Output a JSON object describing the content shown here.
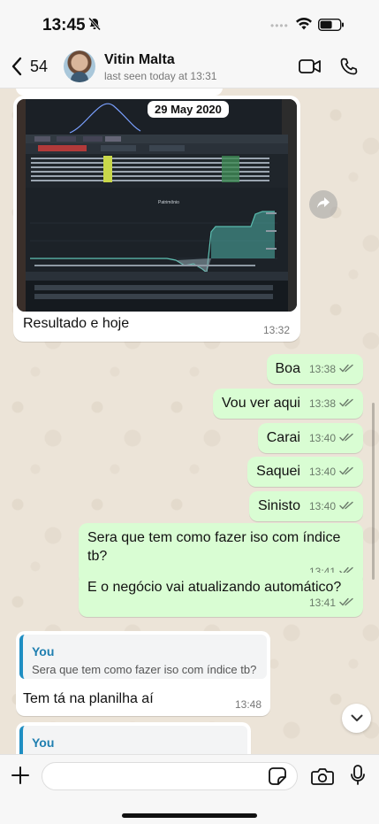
{
  "status_bar": {
    "time": "13:45",
    "icons": [
      "bell-slash-icon",
      "wifi-icon",
      "battery-icon"
    ]
  },
  "header": {
    "back_count": "54",
    "contact_name": "Vitin Malta",
    "last_seen": "last seen today at 13:31",
    "icons": [
      "chevron-left-icon",
      "video-call-icon",
      "phone-call-icon"
    ]
  },
  "messages": {
    "image_message": {
      "date_overlay": "29 May 2020",
      "caption": "Resultado e hoje",
      "time": "13:32",
      "chart_title": "Patrimônio"
    },
    "outgoing": [
      {
        "text": "Boa",
        "time": "13:38"
      },
      {
        "text": "Vou ver aqui",
        "time": "13:38"
      },
      {
        "text": "Carai",
        "time": "13:40"
      },
      {
        "text": "Saquei",
        "time": "13:40"
      },
      {
        "text": "Sinisto",
        "time": "13:40"
      },
      {
        "text": "Sera que tem como fazer iso com índice tb?",
        "time": "13:41"
      },
      {
        "text": "E o negócio vai atualizando automático?",
        "time": "13:41"
      }
    ],
    "reply": {
      "quote_author": "You",
      "quote_text": "Sera que tem como fazer iso com índice tb?",
      "text": "Tem tá na planilha aí",
      "time": "13:48"
    },
    "partial_reply": {
      "quote_author": "You"
    }
  },
  "input_bar": {
    "placeholder": "",
    "icons": [
      "plus-icon",
      "sticker-icon",
      "camera-icon",
      "microphone-icon"
    ]
  },
  "colors": {
    "outgoing_bubble": "#d9fdd3",
    "incoming_bubble": "#ffffff",
    "quote_accent": "#1f8ec2",
    "read_ticks": "#6a7a6a"
  }
}
